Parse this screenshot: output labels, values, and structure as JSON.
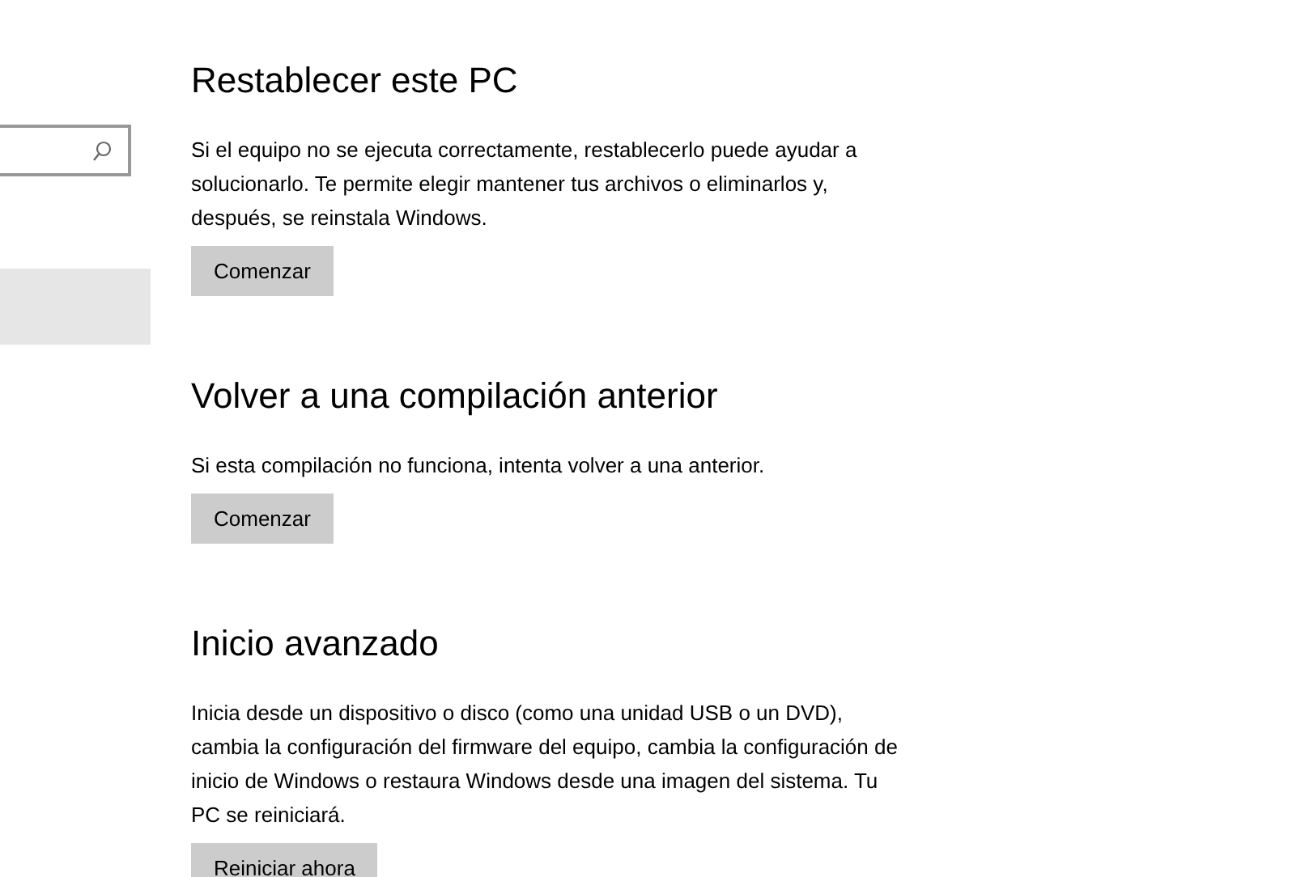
{
  "sidebar": {
    "search": {
      "has_icon": true
    },
    "items": [
      {
        "selected": true
      }
    ]
  },
  "sections": [
    {
      "title": "Restablecer este PC",
      "description": "Si el equipo no se ejecuta correctamente, restablecerlo puede ayudar a solucionarlo. Te permite elegir mantener tus archivos o eliminarlos y, después, se reinstala Windows.",
      "button": "Comenzar"
    },
    {
      "title": "Volver a una compilación anterior",
      "description": "Si esta compilación no funciona, intenta volver a una anterior.",
      "button": "Comenzar"
    },
    {
      "title": "Inicio avanzado",
      "description": "Inicia desde un dispositivo o disco (como una unidad USB o un DVD), cambia la configuración del firmware del equipo, cambia la configuración de inicio de Windows o restaura Windows desde una imagen del sistema. Tu PC se reiniciará.",
      "button": "Reiniciar ahora"
    }
  ]
}
